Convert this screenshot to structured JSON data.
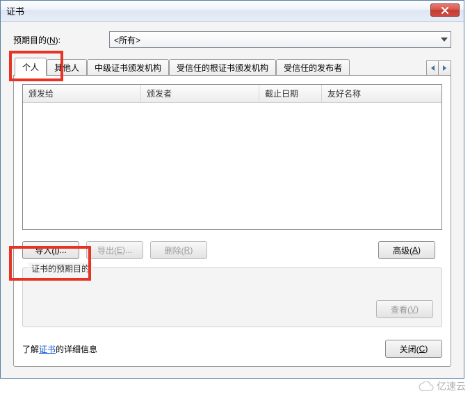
{
  "window": {
    "title": "证书"
  },
  "purpose_row": {
    "label_pre": "预期目的(",
    "label_hot": "N",
    "label_post": "):"
  },
  "purpose_selected": "<所有>",
  "tabs": [
    {
      "label": "个人"
    },
    {
      "label": "其他人"
    },
    {
      "label": "中级证书颁发机构"
    },
    {
      "label": "受信任的根证书颁发机构"
    },
    {
      "label": "受信任的发布者"
    }
  ],
  "list_columns": {
    "c1": "颁发给",
    "c2": "颁发者",
    "c3": "截止日期",
    "c4": "友好名称"
  },
  "buttons": {
    "import_pre": "导入(",
    "import_hot": "I",
    "import_post": ")...",
    "export_pre": "导出(",
    "export_hot": "E",
    "export_post": ")...",
    "remove_pre": "删除(",
    "remove_hot": "R",
    "remove_post": ")",
    "advanced_pre": "高级(",
    "advanced_hot": "A",
    "advanced_post": ")",
    "view_pre": "查看(",
    "view_hot": "V",
    "view_post": ")",
    "close_pre": "关闭(",
    "close_hot": "C",
    "close_post": ")"
  },
  "groupbox": {
    "legend": "证书的预期目的"
  },
  "footer": {
    "before": "了解",
    "link": "证书",
    "after": "的详细信息"
  },
  "watermark": "亿速云"
}
